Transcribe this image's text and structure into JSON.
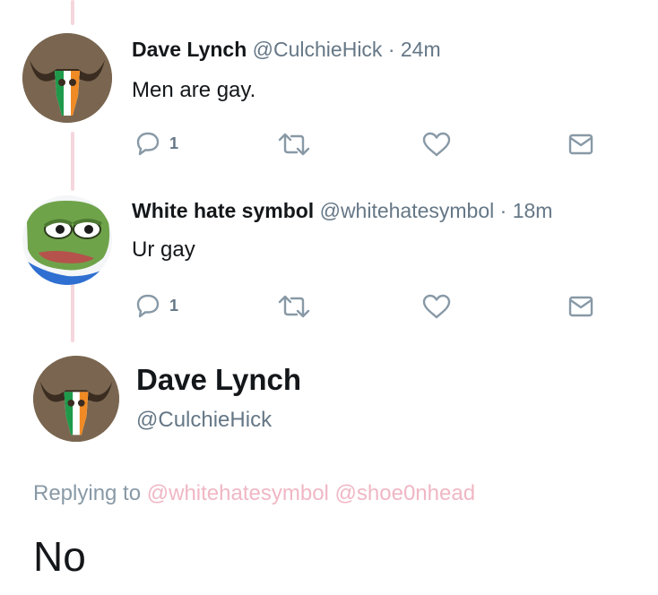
{
  "tweets": [
    {
      "name": "Dave Lynch",
      "handle": "@CulchieHick",
      "sep": "·",
      "time": "24m",
      "text": "Men are gay.",
      "reply_count": "1",
      "avatar_icon": "skull-irish-flag-icon"
    },
    {
      "name": "White hate symbol",
      "handle": "@whitehatesymbol",
      "sep": "·",
      "time": "18m",
      "text": "Ur gay",
      "reply_count": "1",
      "avatar_icon": "frog-icon"
    }
  ],
  "main_tweet": {
    "name": "Dave Lynch",
    "handle": "@CulchieHick",
    "replying_to": "Replying to",
    "mentions": [
      "@whitehatesymbol",
      "@shoe0nhead"
    ],
    "text": "No"
  },
  "colors": {
    "thread_line": "#f5d6dc",
    "meta": "#657786",
    "mention": "#f0b7c4",
    "icon": "#8899a6"
  }
}
